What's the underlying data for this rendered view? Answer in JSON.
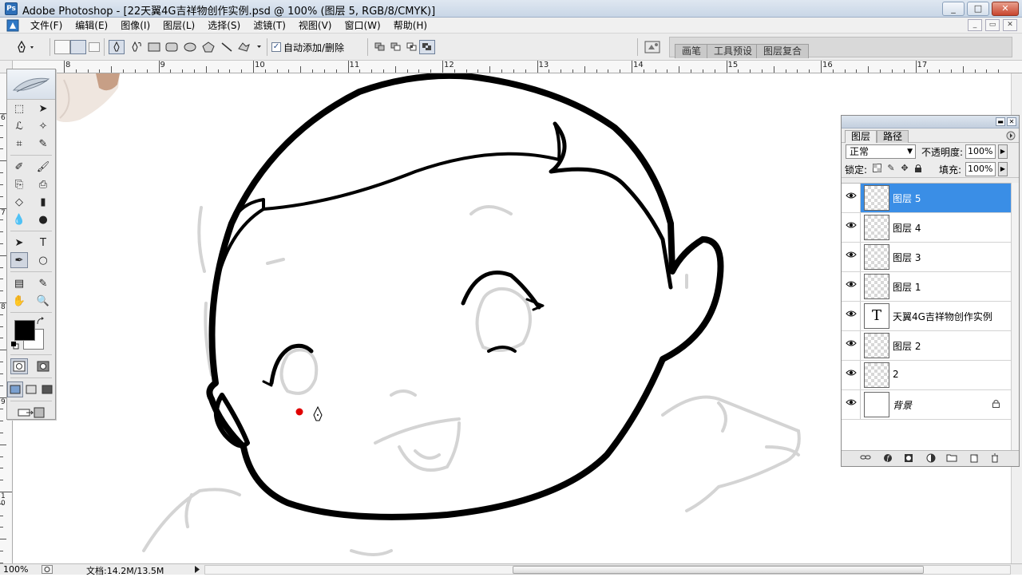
{
  "window": {
    "title": "Adobe Photoshop - [22天翼4G吉祥物创作实例.psd @ 100% (图层 5, RGB/8/CMYK)]",
    "app_icon_text": "Ps",
    "buttons": [
      "_",
      "□",
      "✕"
    ]
  },
  "menu": {
    "items": [
      "文件(F)",
      "编辑(E)",
      "图像(I)",
      "图层(L)",
      "选择(S)",
      "滤镜(T)",
      "视图(V)",
      "窗口(W)",
      "帮助(H)"
    ],
    "doc_buttons": [
      "_",
      "▭",
      "✕"
    ]
  },
  "options": {
    "auto_add_delete_label": "自动添加/删除",
    "auto_add_delete_checked": "✓",
    "palette_well_tabs": [
      "画笔",
      "工具预设",
      "图层复合"
    ]
  },
  "ruler": {
    "h_labels": [
      "8",
      "9",
      "10",
      "11",
      "12",
      "13",
      "14",
      "15",
      "16",
      "17"
    ],
    "v_labels": [
      "6",
      "7",
      "8",
      "9",
      "1 0"
    ]
  },
  "toolbox": {
    "tools": [
      [
        "⬚",
        "➤"
      ],
      [
        "ℒ",
        "✧"
      ],
      [
        "⌗",
        "✎"
      ],
      [
        "✐",
        "🖌"
      ],
      [
        "⎘",
        "⎙"
      ],
      [
        "◇",
        "▮"
      ],
      [
        "💧",
        "●"
      ],
      [
        "➤",
        "T"
      ],
      [
        "✒",
        "○"
      ],
      [
        "▤",
        "✎"
      ],
      [
        "✋",
        "🔍"
      ]
    ]
  },
  "layers_panel": {
    "tabs": [
      "图层",
      "路径"
    ],
    "blend_mode": "正常",
    "opacity_label": "不透明度:",
    "opacity_value": "100%",
    "lock_label": "锁定:",
    "fill_label": "填充:",
    "fill_value": "100%",
    "layers": [
      {
        "name": "图层 5",
        "selected": true,
        "thumb": "checker"
      },
      {
        "name": "图层 4",
        "selected": false,
        "thumb": "checker"
      },
      {
        "name": "图层 3",
        "selected": false,
        "thumb": "checker"
      },
      {
        "name": "图层 1",
        "selected": false,
        "thumb": "checker"
      },
      {
        "name": "天翼4G吉祥物创作实例",
        "selected": false,
        "thumb": "text",
        "thumb_text": "T"
      },
      {
        "name": "图层 2",
        "selected": false,
        "thumb": "checker"
      },
      {
        "name": "2",
        "selected": false,
        "thumb": "checker"
      },
      {
        "name": "背景",
        "selected": false,
        "thumb": "white",
        "locked": true,
        "italic": true
      }
    ],
    "footer_icons": [
      "link-icon",
      "style-icon",
      "mask-icon",
      "adjustment-icon",
      "folder-icon",
      "new-layer-icon",
      "trash-icon"
    ]
  },
  "status": {
    "zoom": "100%",
    "doc_info": "文档:14.2M/13.5M"
  },
  "colors": {
    "selected_layer": "#3a8ee6",
    "red_dot": "#e00000",
    "sketch": "#d4d4d4",
    "outline": "#000000"
  }
}
